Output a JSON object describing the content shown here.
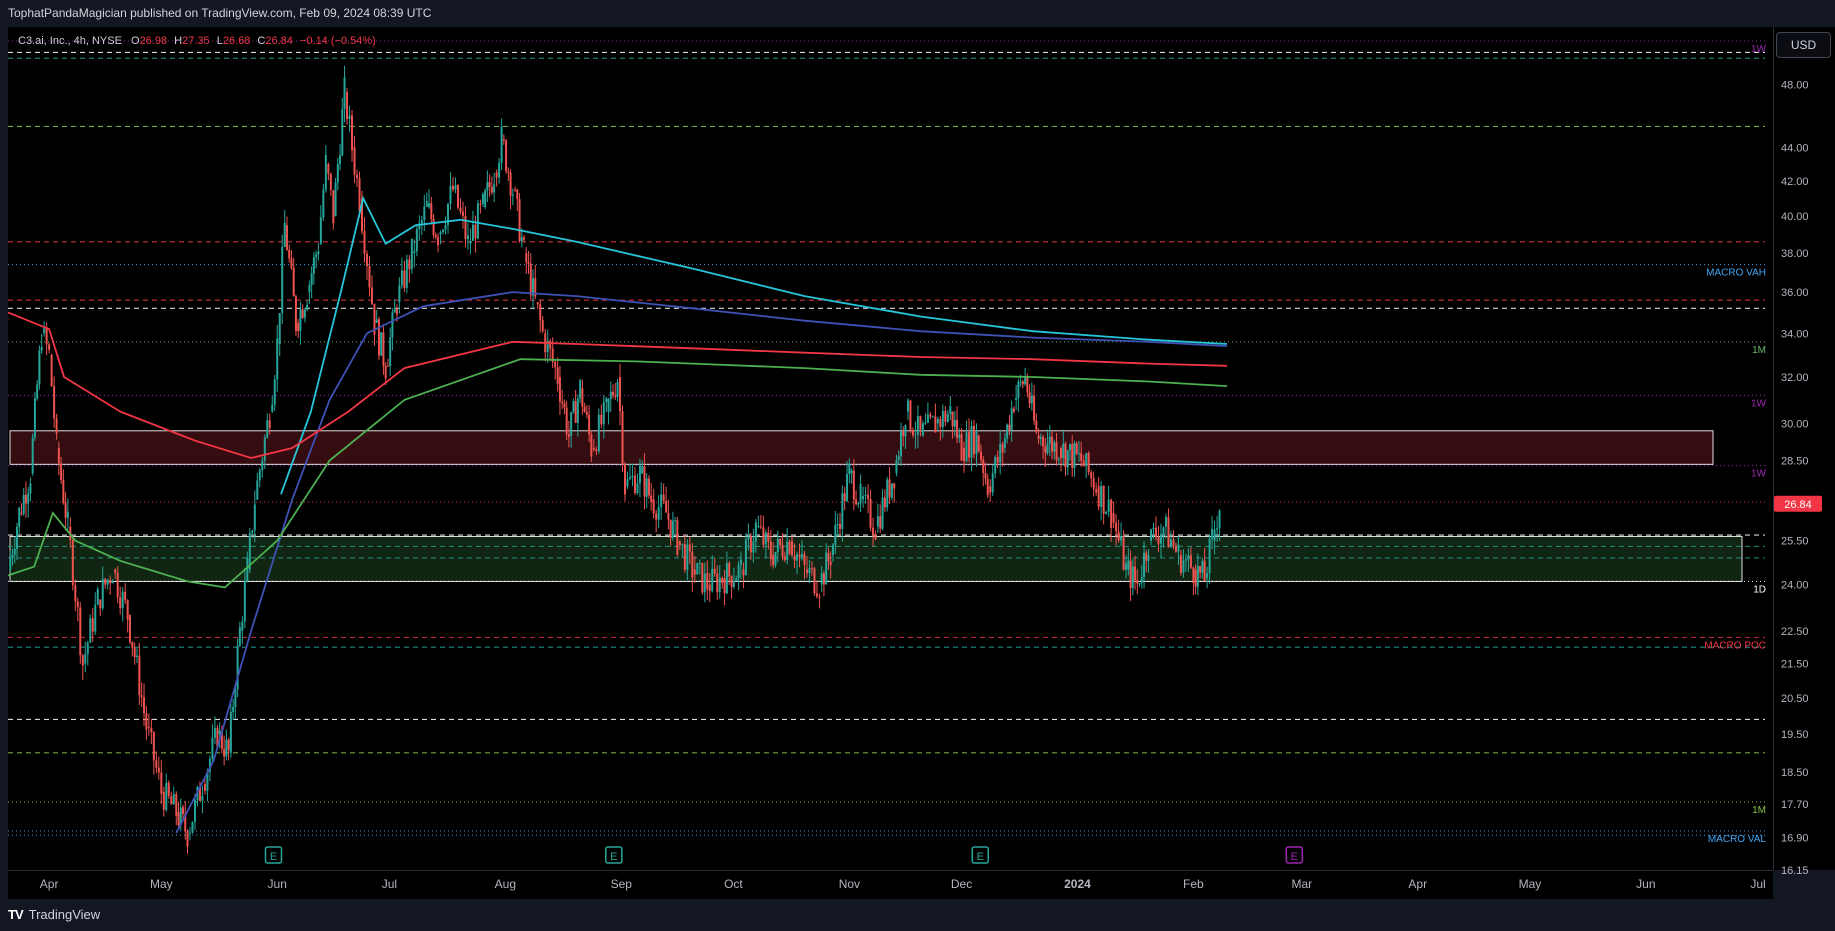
{
  "header": {
    "text": "TophatPandaMagician published on TradingView.com, Feb 09, 2024 08:39 UTC"
  },
  "legend": {
    "symbol": "C3.ai, Inc., 4h, NYSE",
    "open_label": "O",
    "open": "26.98",
    "high_label": "H",
    "high": "27.35",
    "low_label": "L",
    "low": "26.68",
    "close_label": "C",
    "close": "26.84",
    "change": "−0.14 (−0.54%)"
  },
  "currency_button": "USD",
  "footer": {
    "logo": "TV",
    "brand": "TradingView"
  },
  "colors": {
    "bull": "#26a69a",
    "bear": "#ef5350",
    "ma_cyan": "#26c6da",
    "ma_blue": "#3f51b5",
    "ma_red": "#f23645",
    "ma_green": "#4caf50"
  },
  "chart_data": {
    "type": "line",
    "title": "C3.ai, Inc., 4h, NYSE",
    "y_axis": {
      "scale": "log",
      "ticks": [
        "48.00",
        "44.00",
        "42.00",
        "40.00",
        "38.00",
        "36.00",
        "34.00",
        "32.00",
        "30.00",
        "28.50",
        "25.50",
        "24.00",
        "22.50",
        "21.50",
        "20.50",
        "19.50",
        "18.50",
        "17.70",
        "16.90",
        "16.15"
      ],
      "ylim": [
        16.15,
        52
      ]
    },
    "x_axis": {
      "ticks": [
        "Apr",
        "May",
        "Jun",
        "Jul",
        "Aug",
        "Sep",
        "Oct",
        "Nov",
        "Dec",
        "2024",
        "Feb",
        "Mar",
        "Apr",
        "May",
        "Jun",
        "Jul"
      ],
      "xlim": [
        "2023-03-21",
        "2024-07-05"
      ]
    },
    "grid": false,
    "last_price": {
      "value": 26.84,
      "label": "26.84"
    },
    "price_path": [
      [
        "2023-03-21",
        24.5
      ],
      [
        "2023-03-24",
        26.5
      ],
      [
        "2023-03-27",
        28.0
      ],
      [
        "2023-03-30",
        34.0
      ],
      [
        "2023-04-01",
        33.0
      ],
      [
        "2023-04-03",
        29.0
      ],
      [
        "2023-04-06",
        26.0
      ],
      [
        "2023-04-10",
        21.5
      ],
      [
        "2023-04-14",
        23.5
      ],
      [
        "2023-04-18",
        24.5
      ],
      [
        "2023-04-22",
        23.0
      ],
      [
        "2023-04-27",
        19.7
      ],
      [
        "2023-05-01",
        18.0
      ],
      [
        "2023-05-05",
        17.5
      ],
      [
        "2023-05-08",
        17.0
      ],
      [
        "2023-05-12",
        18.2
      ],
      [
        "2023-05-16",
        19.5
      ],
      [
        "2023-05-19",
        19.0
      ],
      [
        "2023-05-22",
        22.5
      ],
      [
        "2023-05-24",
        24.5
      ],
      [
        "2023-05-26",
        27.0
      ],
      [
        "2023-05-30",
        30.5
      ],
      [
        "2023-06-01",
        33.5
      ],
      [
        "2023-06-03",
        39.5
      ],
      [
        "2023-06-06",
        34.5
      ],
      [
        "2023-06-09",
        36.0
      ],
      [
        "2023-06-12",
        38.5
      ],
      [
        "2023-06-14",
        43.0
      ],
      [
        "2023-06-16",
        40.0
      ],
      [
        "2023-06-19",
        47.5
      ],
      [
        "2023-06-21",
        44.0
      ],
      [
        "2023-06-23",
        41.0
      ],
      [
        "2023-06-27",
        34.5
      ],
      [
        "2023-06-30",
        32.5
      ],
      [
        "2023-07-03",
        35.5
      ],
      [
        "2023-07-07",
        38.0
      ],
      [
        "2023-07-11",
        40.5
      ],
      [
        "2023-07-14",
        39.0
      ],
      [
        "2023-07-18",
        41.5
      ],
      [
        "2023-07-22",
        38.5
      ],
      [
        "2023-07-26",
        40.5
      ],
      [
        "2023-07-29",
        42.5
      ],
      [
        "2023-07-31",
        44.5
      ],
      [
        "2023-08-03",
        41.5
      ],
      [
        "2023-08-06",
        38.0
      ],
      [
        "2023-08-09",
        35.5
      ],
      [
        "2023-08-11",
        34.0
      ],
      [
        "2023-08-15",
        32.0
      ],
      [
        "2023-08-18",
        29.5
      ],
      [
        "2023-08-21",
        31.5
      ],
      [
        "2023-08-24",
        29.0
      ],
      [
        "2023-08-28",
        30.5
      ],
      [
        "2023-08-31",
        32.0
      ],
      [
        "2023-09-02",
        27.5
      ],
      [
        "2023-09-06",
        28.0
      ],
      [
        "2023-09-09",
        27.0
      ],
      [
        "2023-09-13",
        26.5
      ],
      [
        "2023-09-16",
        25.5
      ],
      [
        "2023-09-20",
        24.5
      ],
      [
        "2023-09-24",
        24.0
      ],
      [
        "2023-09-28",
        24.2
      ],
      [
        "2023-10-03",
        24.5
      ],
      [
        "2023-10-07",
        26.0
      ],
      [
        "2023-10-11",
        25.0
      ],
      [
        "2023-10-16",
        25.5
      ],
      [
        "2023-10-20",
        24.5
      ],
      [
        "2023-10-24",
        24.0
      ],
      [
        "2023-10-27",
        25.0
      ],
      [
        "2023-11-01",
        28.0
      ],
      [
        "2023-11-04",
        27.0
      ],
      [
        "2023-11-08",
        26.0
      ],
      [
        "2023-11-13",
        28.0
      ],
      [
        "2023-11-16",
        30.5
      ],
      [
        "2023-11-20",
        29.5
      ],
      [
        "2023-11-24",
        30.0
      ],
      [
        "2023-11-28",
        30.5
      ],
      [
        "2023-12-01",
        29.0
      ],
      [
        "2023-12-05",
        29.5
      ],
      [
        "2023-12-08",
        27.5
      ],
      [
        "2023-12-12",
        29.0
      ],
      [
        "2023-12-15",
        31.0
      ],
      [
        "2023-12-18",
        32.0
      ],
      [
        "2023-12-21",
        29.5
      ],
      [
        "2023-12-27",
        29.0
      ],
      [
        "2024-01-02",
        28.5
      ],
      [
        "2024-01-06",
        27.5
      ],
      [
        "2024-01-10",
        26.5
      ],
      [
        "2024-01-14",
        24.5
      ],
      [
        "2024-01-17",
        24.0
      ],
      [
        "2024-01-20",
        25.5
      ],
      [
        "2024-01-24",
        26.0
      ],
      [
        "2024-01-28",
        25.0
      ],
      [
        "2024-02-01",
        24.5
      ],
      [
        "2024-02-04",
        24.2
      ],
      [
        "2024-02-06",
        25.5
      ],
      [
        "2024-02-08",
        26.84
      ]
    ],
    "series": [
      {
        "name": "",
        "color": "#26c6da",
        "values": [
          [
            "2023-06-02",
            27.2
          ],
          [
            "2023-06-10",
            30.5
          ],
          [
            "2023-06-18",
            36.0
          ],
          [
            "2023-06-24",
            41.0
          ],
          [
            "2023-06-30",
            38.5
          ],
          [
            "2023-07-08",
            39.5
          ],
          [
            "2023-07-20",
            39.8
          ],
          [
            "2023-08-03",
            39.3
          ],
          [
            "2023-08-20",
            38.6
          ],
          [
            "2023-09-20",
            37.2
          ],
          [
            "2023-10-20",
            35.8
          ],
          [
            "2023-11-20",
            34.8
          ],
          [
            "2023-12-20",
            34.1
          ],
          [
            "2024-01-20",
            33.7
          ],
          [
            "2024-02-10",
            33.5
          ]
        ]
      },
      {
        "name": "",
        "color": "#3f51b5",
        "values": [
          [
            "2023-05-05",
            17.0
          ],
          [
            "2023-05-15",
            18.8
          ],
          [
            "2023-05-25",
            22.5
          ],
          [
            "2023-06-05",
            27.0
          ],
          [
            "2023-06-15",
            31.0
          ],
          [
            "2023-06-25",
            34.0
          ],
          [
            "2023-07-10",
            35.3
          ],
          [
            "2023-08-03",
            36.0
          ],
          [
            "2023-08-20",
            35.8
          ],
          [
            "2023-09-20",
            35.2
          ],
          [
            "2023-10-20",
            34.6
          ],
          [
            "2023-11-20",
            34.1
          ],
          [
            "2023-12-20",
            33.8
          ],
          [
            "2024-01-20",
            33.6
          ],
          [
            "2024-02-10",
            33.4
          ]
        ]
      },
      {
        "name": "",
        "color": "#f23645",
        "values": [
          [
            "2023-03-21",
            35.0
          ],
          [
            "2023-04-01",
            34.2
          ],
          [
            "2023-04-05",
            32.0
          ],
          [
            "2023-04-20",
            30.5
          ],
          [
            "2023-05-10",
            29.3
          ],
          [
            "2023-05-25",
            28.6
          ],
          [
            "2023-06-05",
            29.0
          ],
          [
            "2023-06-20",
            30.5
          ],
          [
            "2023-07-05",
            32.4
          ],
          [
            "2023-08-03",
            33.6
          ],
          [
            "2023-08-20",
            33.5
          ],
          [
            "2023-09-20",
            33.3
          ],
          [
            "2023-10-20",
            33.1
          ],
          [
            "2023-11-20",
            32.9
          ],
          [
            "2023-12-20",
            32.8
          ],
          [
            "2024-01-20",
            32.6
          ],
          [
            "2024-02-10",
            32.5
          ]
        ]
      },
      {
        "name": "",
        "color": "#4caf50",
        "values": [
          [
            "2023-03-21",
            24.3
          ],
          [
            "2023-03-28",
            24.6
          ],
          [
            "2023-04-02",
            26.5
          ],
          [
            "2023-04-08",
            25.5
          ],
          [
            "2023-04-20",
            24.8
          ],
          [
            "2023-05-08",
            24.1
          ],
          [
            "2023-05-18",
            23.9
          ],
          [
            "2023-06-01",
            25.5
          ],
          [
            "2023-06-15",
            28.5
          ],
          [
            "2023-07-05",
            31.0
          ],
          [
            "2023-08-05",
            32.8
          ],
          [
            "2023-09-05",
            32.7
          ],
          [
            "2023-10-20",
            32.4
          ],
          [
            "2023-11-20",
            32.1
          ],
          [
            "2023-12-20",
            32.0
          ],
          [
            "2024-01-20",
            31.8
          ],
          [
            "2024-02-10",
            31.6
          ]
        ]
      }
    ],
    "zones": [
      {
        "from": 28.35,
        "to": 29.7,
        "color": "#f23645"
      },
      {
        "from": 24.1,
        "to": 25.65,
        "color": "#4caf50"
      }
    ],
    "levels": [
      {
        "price": 51.0,
        "color": "#9c27b0",
        "style": "dotted",
        "label": "1W"
      },
      {
        "price": 50.2,
        "color": "#ffffff",
        "style": "dashed",
        "label": ""
      },
      {
        "price": 49.8,
        "color": "#26a69a",
        "style": "dashed",
        "label": ""
      },
      {
        "price": 45.3,
        "color": "#8bc34a",
        "style": "dashed",
        "label": ""
      },
      {
        "price": 38.6,
        "color": "#f23645",
        "style": "dashed",
        "label": ""
      },
      {
        "price": 37.4,
        "color": "#42a5f5",
        "style": "dotted",
        "label": "MACRO VAH"
      },
      {
        "price": 35.6,
        "color": "#f23645",
        "style": "dashed",
        "label": ""
      },
      {
        "price": 35.2,
        "color": "#ffffff",
        "style": "dashed",
        "label": ""
      },
      {
        "price": 33.6,
        "color": "#66bb6a",
        "style": "dotted",
        "label": "1M"
      },
      {
        "price": 31.2,
        "color": "#9c27b0",
        "style": "dotted",
        "label": "1W"
      },
      {
        "price": 28.3,
        "color": "#9c27b0",
        "style": "dotted",
        "label": "1W"
      },
      {
        "price": 26.9,
        "color": "#f23645",
        "style": "dotted",
        "label": ""
      },
      {
        "price": 25.7,
        "color": "#ffffff",
        "style": "dashed",
        "label": ""
      },
      {
        "price": 25.3,
        "color": "#26a69a",
        "style": "dashed",
        "label": ""
      },
      {
        "price": 24.9,
        "color": "#26a69a",
        "style": "dashed",
        "label": ""
      },
      {
        "price": 24.1,
        "color": "#ffffff",
        "style": "dotted",
        "label": "1D"
      },
      {
        "price": 22.3,
        "color": "#f23645",
        "style": "dashed",
        "label": "MACRO POC"
      },
      {
        "price": 22.0,
        "color": "#26a69a",
        "style": "dashed",
        "label": ""
      },
      {
        "price": 19.9,
        "color": "#ffffff",
        "style": "dashed",
        "label": ""
      },
      {
        "price": 19.0,
        "color": "#8bc34a",
        "style": "dashed",
        "label": ""
      },
      {
        "price": 17.75,
        "color": "#8bc34a",
        "style": "dotted",
        "label": "1M"
      },
      {
        "price": 17.05,
        "color": "#42a5f5",
        "style": "dotted",
        "label": "MACRO VAL"
      },
      {
        "price": 16.95,
        "color": "#42a5f5",
        "style": "dotted",
        "label": ""
      }
    ],
    "events": [
      {
        "date": "2023-05-31",
        "label": "E",
        "color": "#26a69a"
      },
      {
        "date": "2023-08-30",
        "label": "E",
        "color": "#26a69a"
      },
      {
        "date": "2023-12-06",
        "label": "E",
        "color": "#26a69a"
      },
      {
        "date": "2024-02-28",
        "label": "E",
        "color": "#9c27b0"
      }
    ]
  }
}
